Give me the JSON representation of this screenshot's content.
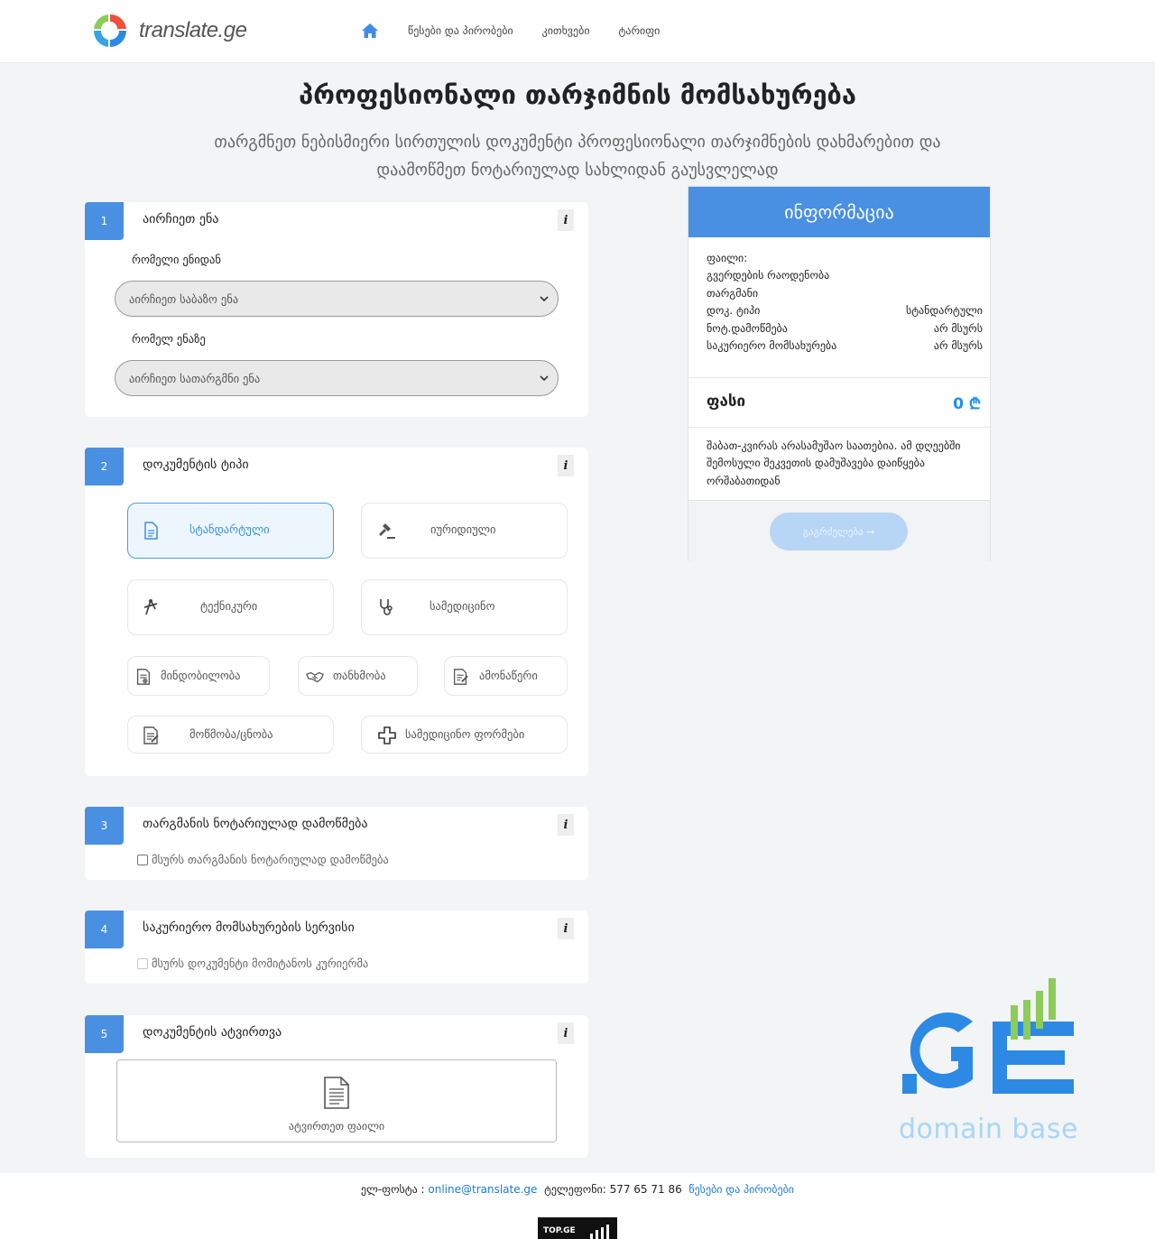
{
  "header": {
    "logo_text": "translate.ge",
    "nav": [
      "წესები და პირობები",
      "კითხვები",
      "ტარიფი"
    ]
  },
  "hero": {
    "title": "პროფესიონალი თარჯიმნის მომსახურება",
    "subtitle": "თარგმნეთ ნებისმიერი სირთულის დოკუმენტი პროფესიონალი თარჯიმნების დახმარებით და დაამოწმეთ ნოტარიულად სახლიდან გაუსვლელად"
  },
  "steps": {
    "s1": {
      "num": "1",
      "title": "აირჩიეთ ენა",
      "from_label": "რომელი ენიდან",
      "from_placeholder": "აირჩიეთ საბაზო ენა",
      "to_label": "რომელ ენაზე",
      "to_placeholder": "აირჩიეთ სათარგმნი ენა"
    },
    "s2": {
      "num": "2",
      "title": "დოკუმენტის ტიპი",
      "types": {
        "standard": "სტანდარტული",
        "legal": "იურიდიული",
        "technical": "ტექნიკური",
        "medical": "სამედიცინო",
        "poa": "მინდობილობა",
        "agreement": "თანხმობა",
        "statement": "ამონაწერი",
        "certificate": "მოწმობა/ცნობა",
        "medforms": "სამედიცინო ფორმები"
      }
    },
    "s3": {
      "num": "3",
      "title": "თარგმანის ნოტარიულად დამოწმება",
      "checkbox_label": "მსურს თარგმანის ნოტარიულად დამოწმება"
    },
    "s4": {
      "num": "4",
      "title": "საკურიერო მომსახურების სერვისი",
      "checkbox_label": "მსურს დოკუმენტი მომიტანოს კურიერმა"
    },
    "s5": {
      "num": "5",
      "title": "დოკუმენტის ატვირთვა",
      "upload_label": "ატვირთეთ ფაილი"
    },
    "info_symbol": "i"
  },
  "info_panel": {
    "title": "ინფორმაცია",
    "rows": [
      {
        "label": "ფაილი:",
        "value": ""
      },
      {
        "label": "გვერდების რაოდენობა",
        "value": ""
      },
      {
        "label": "თარგმანი",
        "value": ""
      },
      {
        "label": "დოკ. ტიპი",
        "value": "სტანდარტული"
      },
      {
        "label": "ნოტ.დამოწმება",
        "value": "არ მსურს"
      },
      {
        "label": "საკურიერო მომსახურება",
        "value": "არ მსურს"
      }
    ],
    "price_label": "ფასი",
    "price_value": "0 ₾",
    "notice": "შაბათ-კვირას არასამუშაო საათებია. ამ დღეებში შემოსული შეკვეთის დამუშავება დაიწყება ორშაბათიდან",
    "continue_label": "გაგრძელება ➞"
  },
  "domain_logo": {
    "sub": "domain base",
    "colors": {
      "blue": "#2d8ae4",
      "green": "#8ccc5a"
    }
  },
  "footer": {
    "email_label": "ელ-ფოსტა : ",
    "email": "online@translate.ge",
    "phone": "ტელეფონი: 577 65 71 86",
    "terms_link": "წესები და პირობები",
    "counter": "TOP.GE"
  },
  "colors": {
    "accent": "#4a90e2",
    "link": "#1a7bd6",
    "active_border": "#4a9de6"
  }
}
